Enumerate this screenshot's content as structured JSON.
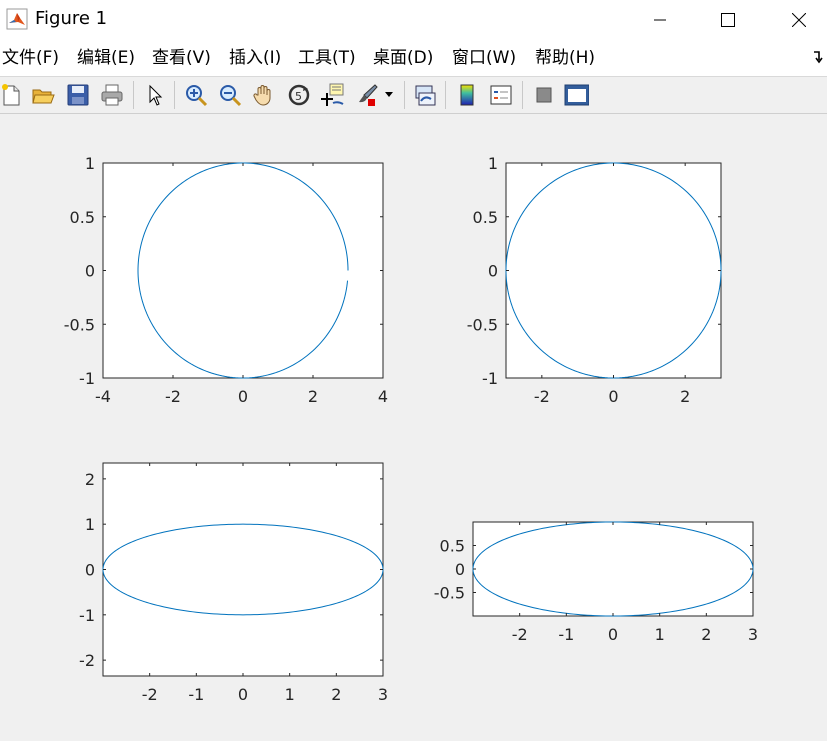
{
  "window": {
    "title": "Figure 1",
    "minimize_icon": "minimize-icon",
    "maximize_icon": "maximize-icon",
    "close_icon": "close-icon"
  },
  "menu": {
    "items": [
      "文件(F)",
      "编辑(E)",
      "查看(V)",
      "插入(I)",
      "工具(T)",
      "桌面(D)",
      "窗口(W)",
      "帮助(H)"
    ]
  },
  "toolbar": {
    "buttons": [
      "new-figure-icon",
      "open-file-icon",
      "save-icon",
      "print-icon",
      "pointer-icon",
      "zoom-in-icon",
      "zoom-out-icon",
      "pan-hand-icon",
      "rotate-3d-icon",
      "data-cursor-icon",
      "brush-icon",
      "brush-dropdown-icon",
      "link-plot-icon",
      "colorbar-icon",
      "legend-icon",
      "hide-plot-tools-icon",
      "show-plot-tools-icon"
    ]
  },
  "colors": {
    "line": "#0072bd",
    "figure_bg": "#f0f0f0",
    "axes_bg": "#ffffff"
  },
  "chart_data": [
    {
      "type": "line",
      "title": "",
      "series": [
        {
          "curve": "x = 3cos(t), y = sin(t), t from 0 to 2π",
          "shape": "circle drawn with equal axis, slightly clipped at right"
        }
      ],
      "xlim": [
        -4,
        4
      ],
      "ylim": [
        -1,
        1
      ],
      "xticks": [
        "-4",
        "-2",
        "0",
        "2",
        "4"
      ],
      "yticks": [
        "1",
        "0.5",
        "0",
        "-0.5",
        "-1"
      ],
      "grid": false
    },
    {
      "type": "line",
      "title": "",
      "series": [
        {
          "curve": "x = 3cos(t), y = sin(t), t from 0 to 2π",
          "shape": "axis square / tight"
        }
      ],
      "xlim": [
        -3,
        3
      ],
      "ylim": [
        -1,
        1
      ],
      "xticks": [
        "-2",
        "0",
        "2"
      ],
      "yticks": [
        "1",
        "0.5",
        "0",
        "-0.5",
        "-1"
      ],
      "grid": false
    },
    {
      "type": "line",
      "title": "",
      "series": [
        {
          "curve": "x = 3cos(t), y = sin(t), t from 0 to 2π",
          "shape": "ellipse, axis equal with box aspect"
        }
      ],
      "xlim": [
        -3,
        3
      ],
      "ylim": [
        -2.35,
        2.35
      ],
      "xticks": [
        "-2",
        "-1",
        "0",
        "1",
        "2",
        "3"
      ],
      "yticks": [
        "2",
        "1",
        "0",
        "-1",
        "-2"
      ],
      "grid": false
    },
    {
      "type": "line",
      "title": "",
      "series": [
        {
          "curve": "x = 3cos(t), y = sin(t), t from 0 to 2π",
          "shape": "ellipse, axis image"
        }
      ],
      "xlim": [
        -3,
        3
      ],
      "ylim": [
        -1,
        1
      ],
      "xticks": [
        "-2",
        "-1",
        "0",
        "1",
        "2",
        "3"
      ],
      "yticks": [
        "0.5",
        "0",
        "-0.5"
      ],
      "grid": false
    }
  ]
}
